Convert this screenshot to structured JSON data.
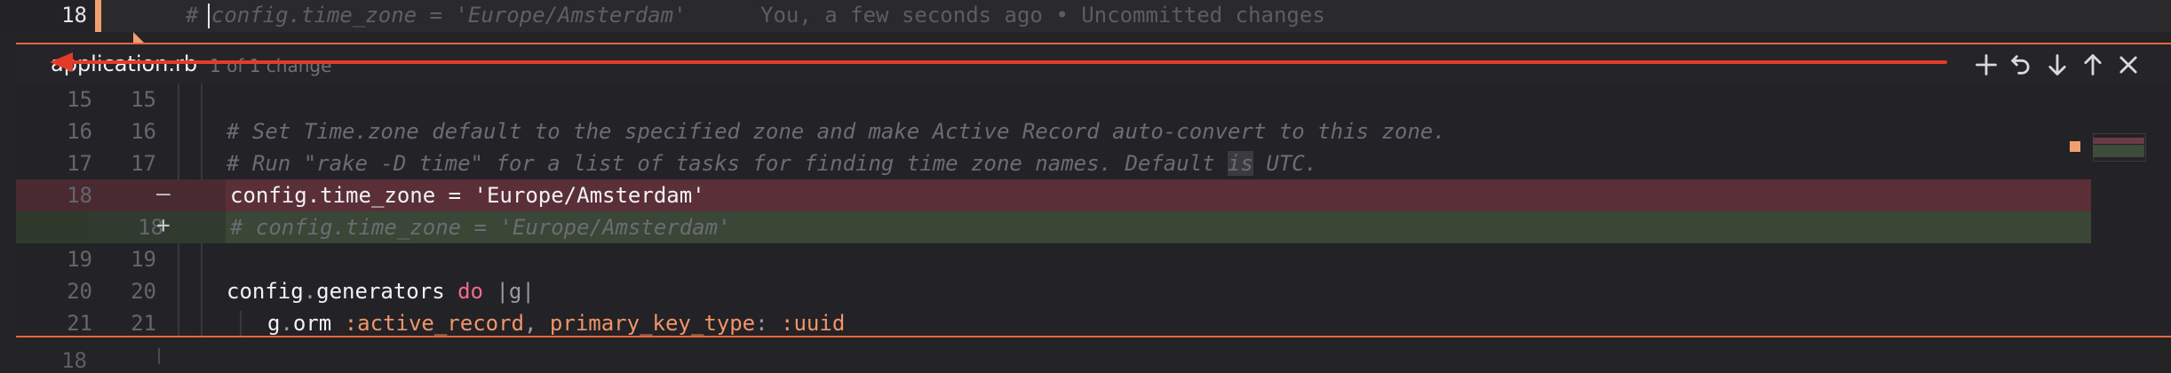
{
  "editor": {
    "top_line": {
      "line_number": "18",
      "code": "# config.time_zone = 'Europe/Amsterdam'",
      "blame": "You, a few seconds ago • Uncommitted changes"
    },
    "below_line": {
      "line_number": "18"
    }
  },
  "peek": {
    "filename": "application.rb",
    "meta": "1 of 1 change",
    "toolbar": {
      "stage_icon": "plus-icon",
      "revert_icon": "undo-icon",
      "next_icon": "arrow-down-icon",
      "prev_icon": "arrow-up-icon",
      "close_icon": "close-icon"
    },
    "rows": [
      {
        "old": "15",
        "new": "15",
        "sign": "",
        "code": ""
      },
      {
        "old": "16",
        "new": "16",
        "sign": "",
        "code": "# Set Time.zone default to the specified zone and make Active Record auto-convert to this zone."
      },
      {
        "old": "17",
        "new": "17",
        "sign": "",
        "code_pre": "# Run \"rake -D time\" for a list of tasks for finding time zone names. Default ",
        "code_hl": "is",
        "code_post": " UTC."
      },
      {
        "old": "18",
        "new": "",
        "sign": "—",
        "code": "config.time_zone = 'Europe/Amsterdam'"
      },
      {
        "old": "",
        "new": "18",
        "sign": "+",
        "code": "# config.time_zone = 'Europe/Amsterdam'"
      },
      {
        "old": "19",
        "new": "19",
        "sign": "",
        "code": ""
      },
      {
        "old": "20",
        "new": "20",
        "sign": "",
        "code_a": "config",
        "code_b": ".",
        "code_c": "generators",
        "code_d": " do ",
        "code_e": "|g|"
      },
      {
        "old": "21",
        "new": "21",
        "sign": "",
        "code_a": "g",
        "code_b": ".",
        "code_c": "orm",
        "code_d": " :active_record",
        "code_e": ", ",
        "code_f": "primary_key_type",
        "code_g": ": ",
        "code_h": ":uuid"
      }
    ]
  },
  "colors": {
    "accent": "#e8663b",
    "arrow": "#e43b28",
    "deleted": "#5a2f38",
    "added": "#3a4636"
  }
}
